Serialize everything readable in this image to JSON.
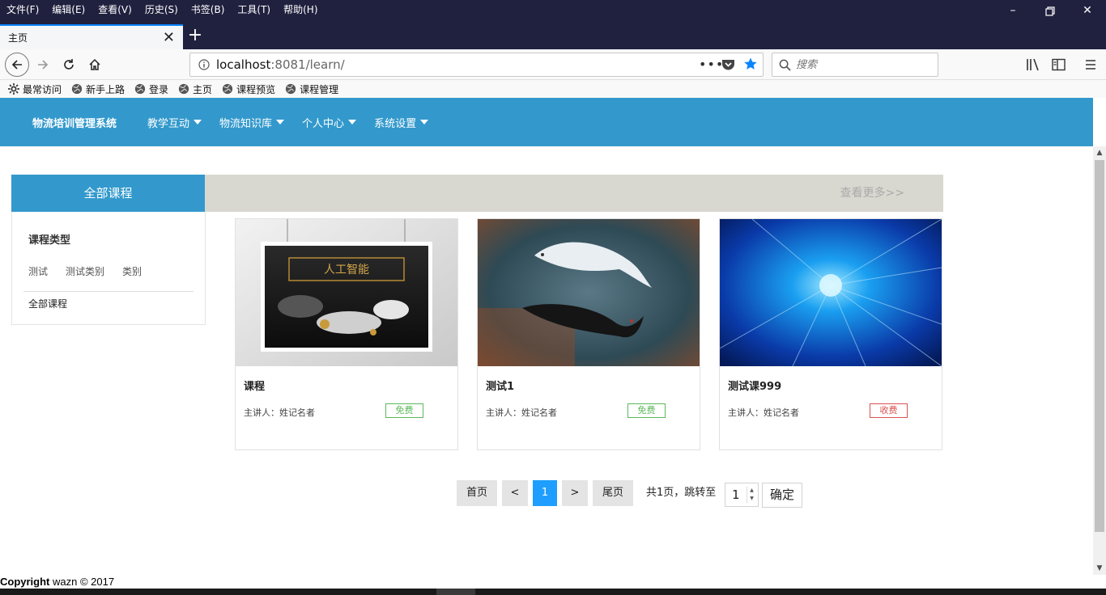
{
  "browser": {
    "menu": [
      "文件(F)",
      "编辑(E)",
      "查看(V)",
      "历史(S)",
      "书签(B)",
      "工具(T)",
      "帮助(H)"
    ],
    "tab_title": "主页",
    "url_host": "localhost",
    "url_rest": ":8081/learn/",
    "search_placeholder": "搜索",
    "bookmarks": [
      "最常访问",
      "新手上路",
      "登录",
      "主页",
      "课程预览",
      "课程管理"
    ]
  },
  "site": {
    "brand": "物流培训管理系统",
    "nav": [
      "教学互动",
      "物流知识库",
      "个人中心",
      "系统设置"
    ]
  },
  "sidebar": {
    "heading": "全部课程",
    "type_label": "课程类型",
    "tags": [
      "测试",
      "测试类别",
      "类别"
    ],
    "all_label": "全部课程"
  },
  "more_link": "查看更多>>",
  "courses": [
    {
      "title": "课程",
      "lecturer": "主讲人：姓记名者",
      "badge": "免费",
      "badge_type": "free",
      "image": "ai-poster"
    },
    {
      "title": "测试1",
      "lecturer": "主讲人：姓记名者",
      "badge": "免费",
      "badge_type": "free",
      "image": "koi-fish"
    },
    {
      "title": "测试课999",
      "lecturer": "主讲人：姓记名者",
      "badge": "收费",
      "badge_type": "paid",
      "image": "digital-tunnel"
    }
  ],
  "pager": {
    "first": "首页",
    "prev": "<",
    "current": "1",
    "next": ">",
    "last": "尾页",
    "summary": "共1页，跳转至",
    "jump_value": "1",
    "confirm": "确定"
  },
  "footer": {
    "copyright_bold": "Copyright",
    "copyright_rest": " wazn © 2017"
  },
  "colors": {
    "header": "#3399cc",
    "current_page": "#1e9fff",
    "free": "#5cb85c",
    "paid": "#d9534f"
  }
}
